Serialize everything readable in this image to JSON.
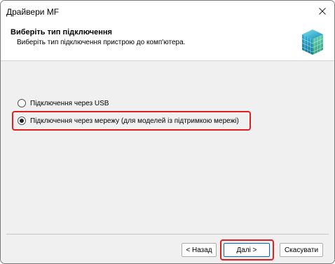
{
  "window": {
    "title": "Драйвери MF",
    "close_icon": "close-icon"
  },
  "header": {
    "title": "Виберіть тип підключення",
    "subtitle": "Виберіть тип підключення пристрою до комп'ютера.",
    "icon": "printer-cube-icon",
    "icon_color": "#1ba6c9"
  },
  "options": {
    "usb_label": "Підключення через USB",
    "network_label": "Підключення через мережу (для моделей із підтримкою мережі)",
    "selected": "network"
  },
  "footer": {
    "back_label": "< Назад",
    "next_label": "Далі >",
    "cancel_label": "Скасувати"
  },
  "highlight_color": "#e02020"
}
